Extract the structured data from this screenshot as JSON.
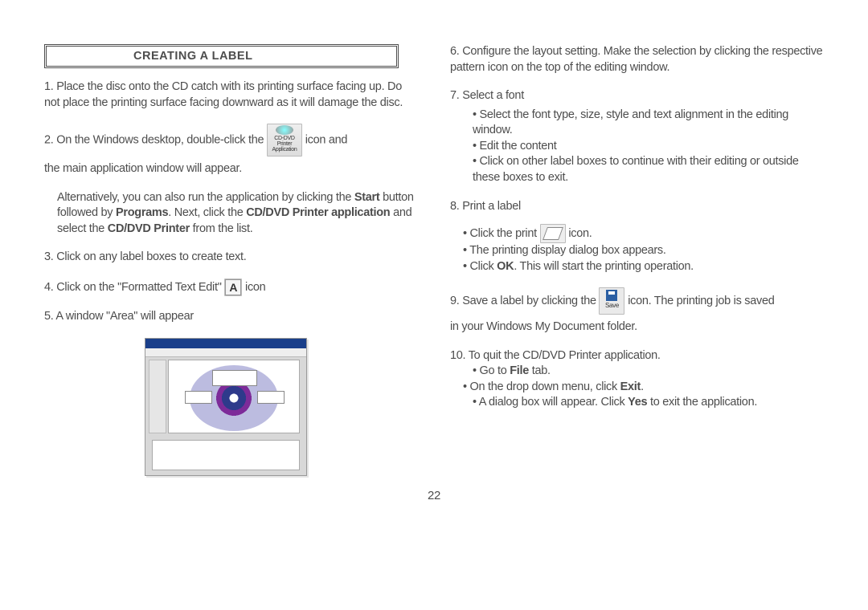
{
  "heading": "CREATING A LABEL",
  "left": {
    "step1": "1. Place the disc onto the CD catch with its printing surface facing up. Do not place the printing surface facing downward as it will damage the disc.",
    "step2a": "2. On the Windows  desktop, double-click the",
    "step2b": "icon and",
    "step2c": "the main application window will appear.",
    "step2alt_a": "Alternatively, you can also run the  application by clicking the ",
    "step2alt_b": "Start",
    "step2alt_c": " button followed by ",
    "step2alt_d": "Programs",
    "step2alt_e": ". Next, click the ",
    "step2alt_f": "CD/DVD Printer application",
    "step2alt_g": " and select the ",
    "step2alt_h": "CD/DVD Printer",
    "step2alt_i": " from the list.",
    "step3": "3. Click on any label boxes to create text.",
    "step4a": "4. Click on the \"Formatted Text Edit\"  ",
    "step4b": "  icon",
    "step5": "5. A window  \"Area\"  will appear",
    "app_icon_label1": "CD-DVD",
    "app_icon_label2": "Printer",
    "app_icon_label3": "Application"
  },
  "right": {
    "step6": "6. Configure the layout setting. Make the selection by clicking the respective pattern icon on the top of the editing window.",
    "step7": "7. Select  a font",
    "step7a": "Select the font type, size, style and text alignment in the editing window.",
    "step7b": "Edit  the content",
    "step7c": "Click on other label boxes to continue with their editing or outside these boxes to exit.",
    "step8": "8. Print  a label",
    "step8a_a": "Click the print",
    "step8a_b": "icon.",
    "step8b": "The printing display dialog box appears.",
    "step8c_a": "Click ",
    "step8c_b": "OK",
    "step8c_c": ". This will start the printing operation.",
    "step9a": "9. Save a label by clicking the ",
    "step9b": " icon. The printing job is saved",
    "step9c": "in your Windows My Document folder.",
    "save_label": "Save",
    "step10": "10. To quit  the CD/DVD Printer application.",
    "step10a_a": " Go to ",
    "step10a_b": "File",
    "step10a_c": " tab.",
    "step10b_a": "On the drop down menu, click ",
    "step10b_b": "Exit",
    "step10b_c": ".",
    "step10c_a": " A dialog box  will appear. Click ",
    "step10c_b": "Yes",
    "step10c_c": " to exit  the application."
  },
  "pagenum": "22"
}
